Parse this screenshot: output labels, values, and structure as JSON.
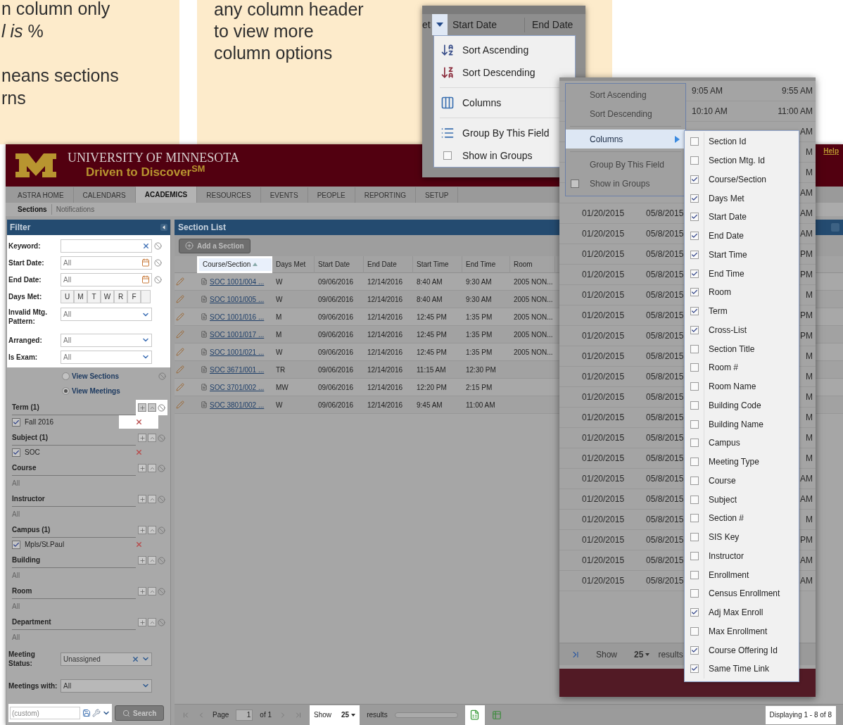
{
  "notes": [
    {
      "paragraphs": [
        [
          "n column only",
          "*l is* %"
        ],
        [
          "neans sections",
          "rns"
        ]
      ]
    },
    {
      "paragraphs": [
        [
          "any column header",
          "to view more",
          "column options"
        ]
      ]
    }
  ],
  "app": {
    "brand": {
      "title": "UNIVERSITY OF MINNESOTA",
      "tagline": "Driven to Discover$^{SM}$"
    },
    "help": "Help",
    "tabs": [
      {
        "label": "ASTRA HOME",
        "selected": false
      },
      {
        "label": "CALENDARS",
        "selected": false
      },
      {
        "label": "ACADEMICS",
        "selected": true
      },
      {
        "label": "RESOURCES",
        "selected": false
      },
      {
        "label": "EVENTS",
        "selected": false
      },
      {
        "label": "PEOPLE",
        "selected": false
      },
      {
        "label": "REPORTING",
        "selected": false
      },
      {
        "label": "SETUP",
        "selected": false
      }
    ],
    "subtabs": [
      {
        "label": "Sections",
        "selected": true
      },
      {
        "label": "Notifications",
        "selected": false
      }
    ],
    "filter": {
      "title": "Filter",
      "highlighted": true,
      "fields": [
        {
          "kind": "text",
          "label": "Keyword:"
        },
        {
          "kind": "date",
          "label": "Start Date:",
          "value": "All"
        },
        {
          "kind": "date",
          "label": "End Date:",
          "value": "All"
        },
        {
          "kind": "days",
          "label": "Days Met:",
          "days": [
            "U",
            "M",
            "T",
            "W",
            "R",
            "F"
          ]
        },
        {
          "kind": "select",
          "label": "Invalid Mtg. Pattern:",
          "value": "All"
        },
        {
          "kind": "select",
          "label": "Arranged:",
          "value": "All"
        },
        {
          "kind": "select",
          "label": "Is Exam:",
          "value": "All"
        }
      ],
      "views": [
        {
          "label": "View Sections",
          "selected": false
        },
        {
          "label": "View Meetings",
          "selected": true
        }
      ],
      "groups": [
        {
          "title": "Term (1)",
          "highlighted": true,
          "items": [
            {
              "label": "Fall 2016",
              "checked": true
            }
          ]
        },
        {
          "title": "Subject (1)",
          "highlighted": false,
          "items": [
            {
              "label": "SOC",
              "checked": true
            }
          ]
        },
        {
          "title": "Course",
          "highlighted": false,
          "value": "All"
        },
        {
          "title": "Instructor",
          "highlighted": false,
          "value": "All"
        },
        {
          "title": "Campus (1)",
          "highlighted": false,
          "items": [
            {
              "label": "Mpls/St.Paul",
              "checked": true
            }
          ]
        },
        {
          "title": "Building",
          "highlighted": false,
          "value": "All"
        },
        {
          "title": "Room",
          "highlighted": false,
          "value": "All"
        },
        {
          "title": "Department",
          "highlighted": false,
          "value": "All"
        }
      ],
      "bottom_fields": [
        {
          "label": "Meeting Status:",
          "value": "Unassigned",
          "clearable": true
        },
        {
          "label": "Meetings with:",
          "value": "All",
          "clearable": false
        }
      ],
      "search": {
        "placeholder": "(custom)",
        "highlighted": true,
        "button": "Search"
      }
    },
    "section_list": {
      "title": "Section List",
      "add_button": "Add a Section",
      "columns": [
        {
          "label": "Course/Section",
          "highlighted": true,
          "sorted": true
        },
        {
          "label": "Days Met",
          "highlighted": false,
          "sorted": false
        },
        {
          "label": "Start Date",
          "highlighted": false,
          "sorted": false
        },
        {
          "label": "End Date",
          "highlighted": false,
          "sorted": false
        },
        {
          "label": "Start Time",
          "highlighted": false,
          "sorted": false
        },
        {
          "label": "End Time",
          "highlighted": false,
          "sorted": false
        },
        {
          "label": "Room",
          "highlighted": false,
          "sorted": false
        }
      ],
      "rows": [
        [
          "SOC 1001/004 ...",
          "W",
          "09/06/2016",
          "12/14/2016",
          "8:40 AM",
          "9:30 AM",
          "2005 NON..."
        ],
        [
          "SOC 1001/005 ...",
          "W",
          "09/06/2016",
          "12/14/2016",
          "8:40 AM",
          "9:30 AM",
          "2005 NON..."
        ],
        [
          "SOC 1001/016 ...",
          "M",
          "09/06/2016",
          "12/14/2016",
          "12:45 PM",
          "1:35 PM",
          "2005 NON..."
        ],
        [
          "SOC 1001/017 ...",
          "M",
          "09/06/2016",
          "12/14/2016",
          "12:45 PM",
          "1:35 PM",
          "2005 NON..."
        ],
        [
          "SOC 1001/021 ...",
          "W",
          "09/06/2016",
          "12/14/2016",
          "12:45 PM",
          "1:35 PM",
          "2005 NON..."
        ],
        [
          "SOC 3671/001 ...",
          "TR",
          "09/06/2016",
          "12/14/2016",
          "11:15 AM",
          "12:30 PM"
        ],
        [
          "SOC 3701/002 ...",
          "MW",
          "09/06/2016",
          "12/14/2016",
          "12:20 PM",
          "2:15 PM"
        ],
        [
          "SOC 3801/002 ...",
          "W",
          "09/06/2016",
          "12/14/2016",
          "9:45 AM",
          "11:00 AM"
        ]
      ]
    },
    "pager": {
      "page_label": "Page",
      "page": "1",
      "of": "of 1",
      "show": "Show",
      "page_size": "25",
      "results": "results",
      "show_highlighted": true,
      "export_highlighted": true,
      "displaying": "Displaying 1 - 8 of 8"
    }
  },
  "column_menu": {
    "header": [
      "et",
      "Start Date",
      "End Date"
    ],
    "items": [
      {
        "kind": "sort_asc",
        "label": "Sort Ascending"
      },
      {
        "kind": "sort_desc",
        "label": "Sort Descending"
      },
      {
        "kind": "columns",
        "label": "Columns"
      },
      {
        "kind": "group",
        "label": "Group By This Field"
      },
      {
        "kind": "check",
        "label": "Show in Groups",
        "checked": false
      }
    ]
  },
  "columns_window": {
    "menu": [
      {
        "kind": "sort_asc",
        "label": "Sort Ascending",
        "selected": false
      },
      {
        "kind": "sort_desc",
        "label": "Sort Descending",
        "selected": false
      },
      {
        "kind": "columns",
        "label": "Columns",
        "selected": true
      },
      {
        "kind": "group",
        "label": "Group By This Field",
        "selected": false
      },
      {
        "kind": "check",
        "label": "Show in Groups",
        "checked": false,
        "selected": false
      }
    ],
    "rows": [
      {
        "start_time": "9:05 AM",
        "end_time": "9:55 AM"
      },
      {
        "start_time": "10:10 AM",
        "end_time": "11:00 AM"
      },
      {
        "end_time": "AM"
      },
      {
        "end_time": "M"
      },
      {
        "end_time": "M"
      },
      {
        "end_time": "AM"
      },
      {
        "start_date": "01/20/2015",
        "end_date": "05/8/2015",
        "end_time": "AM"
      },
      {
        "start_date": "01/20/2015",
        "end_date": "05/8/2015",
        "end_time": "AM"
      },
      {
        "start_date": "01/20/2015",
        "end_date": "05/8/2015",
        "end_time": "PM"
      },
      {
        "start_date": "01/20/2015",
        "end_date": "05/8/2015",
        "end_time": "PM"
      },
      {
        "start_date": "01/20/2015",
        "end_date": "05/8/2015",
        "end_time": "M"
      },
      {
        "start_date": "01/20/2015",
        "end_date": "05/8/2015",
        "end_time": "PM"
      },
      {
        "start_date": "01/20/2015",
        "end_date": "05/8/2015",
        "end_time": "PM"
      },
      {
        "start_date": "01/20/2015",
        "end_date": "05/8/2015",
        "end_time": "M"
      },
      {
        "start_date": "01/20/2015",
        "end_date": "05/8/2015",
        "end_time": "M"
      },
      {
        "start_date": "01/20/2015",
        "end_date": "05/8/2015",
        "end_time": "M"
      },
      {
        "start_date": "01/20/2015",
        "end_date": "05/8/2015",
        "end_time": "M"
      },
      {
        "start_date": "01/20/2015",
        "end_date": "05/8/2015",
        "end_time": "M"
      },
      {
        "start_date": "01/20/2015",
        "end_date": "05/8/2015",
        "end_time": "M"
      },
      {
        "start_date": "01/20/2015",
        "end_date": "05/8/2015",
        "end_time": "AM"
      },
      {
        "start_date": "01/20/2015",
        "end_date": "05/8/2015",
        "end_time": "AM"
      },
      {
        "start_date": "01/20/2015",
        "end_date": "05/8/2015",
        "end_time": "M"
      },
      {
        "start_date": "01/20/2015",
        "end_date": "05/8/2015",
        "end_time": "PM"
      },
      {
        "start_date": "01/20/2015",
        "end_date": "05/8/2015",
        "end_time": "AM"
      },
      {
        "start_date": "01/20/2015",
        "end_date": "05/8/2015",
        "end_time": "AM"
      }
    ],
    "submenu": [
      {
        "label": "Section Id",
        "checked": false
      },
      {
        "label": "Section Mtg. Id",
        "checked": false
      },
      {
        "label": "Course/Section",
        "checked": true
      },
      {
        "label": "Days Met",
        "checked": true
      },
      {
        "label": "Start Date",
        "checked": true
      },
      {
        "label": "End Date",
        "checked": true
      },
      {
        "label": "Start Time",
        "checked": true
      },
      {
        "label": "End Time",
        "checked": true
      },
      {
        "label": "Room",
        "checked": true
      },
      {
        "label": "Term",
        "checked": true
      },
      {
        "label": "Cross-List",
        "checked": true
      },
      {
        "label": "Section Title",
        "checked": false
      },
      {
        "label": "Room #",
        "checked": false
      },
      {
        "label": "Room Name",
        "checked": false
      },
      {
        "label": "Building Code",
        "checked": false
      },
      {
        "label": "Building Name",
        "checked": false
      },
      {
        "label": "Campus",
        "checked": false
      },
      {
        "label": "Meeting Type",
        "checked": false
      },
      {
        "label": "Course",
        "checked": false
      },
      {
        "label": "Subject",
        "checked": false
      },
      {
        "label": "Section #",
        "checked": false
      },
      {
        "label": "SIS Key",
        "checked": false
      },
      {
        "label": "Instructor",
        "checked": false
      },
      {
        "label": "Enrollment",
        "checked": false
      },
      {
        "label": "Census Enrollment",
        "checked": false
      },
      {
        "label": "Adj Max Enroll",
        "checked": true
      },
      {
        "label": "Max Enrollment",
        "checked": false
      },
      {
        "label": "Course Offering Id",
        "checked": true
      },
      {
        "label": "Same Time Link",
        "checked": true
      }
    ],
    "footer": {
      "show": "Show",
      "page_size": "25",
      "results": "results"
    }
  }
}
